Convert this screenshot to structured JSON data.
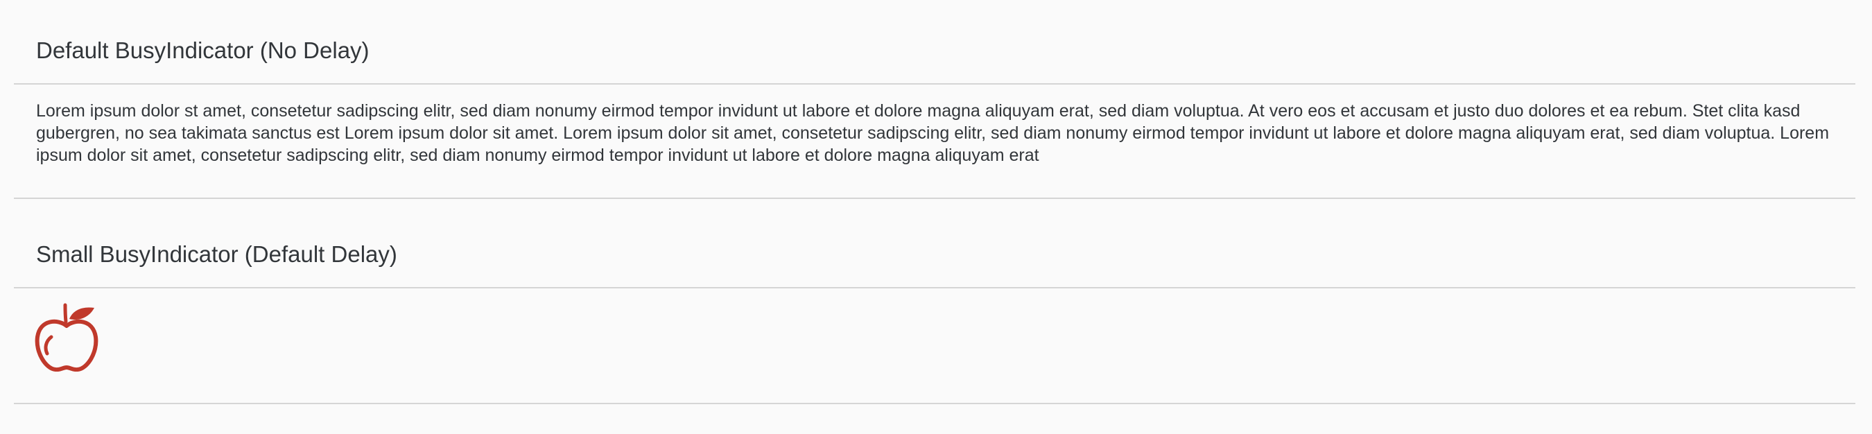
{
  "sections": [
    {
      "title": "Default BusyIndicator (No Delay)",
      "text": "Lorem ipsum dolor st amet, consetetur sadipscing elitr, sed diam nonumy eirmod tempor invidunt ut labore et dolore magna aliquyam erat, sed diam voluptua. At vero eos et accusam et justo duo dolores et ea rebum. Stet clita kasd gubergren, no sea takimata sanctus est Lorem ipsum dolor sit amet. Lorem ipsum dolor sit amet, consetetur sadipscing elitr, sed diam nonumy eirmod tempor invidunt ut labore et dolore magna aliquyam erat, sed diam voluptua. Lorem ipsum dolor sit amet, consetetur sadipscing elitr, sed diam nonumy eirmod tempor invidunt ut labore et dolore magna aliquyam erat"
    },
    {
      "title": "Small BusyIndicator (Default Delay)",
      "icon": "apple-icon"
    }
  ],
  "colors": {
    "background": "#fafafa",
    "text": "#32363a",
    "divider": "#d5d5d5",
    "icon": "#c0392b"
  }
}
